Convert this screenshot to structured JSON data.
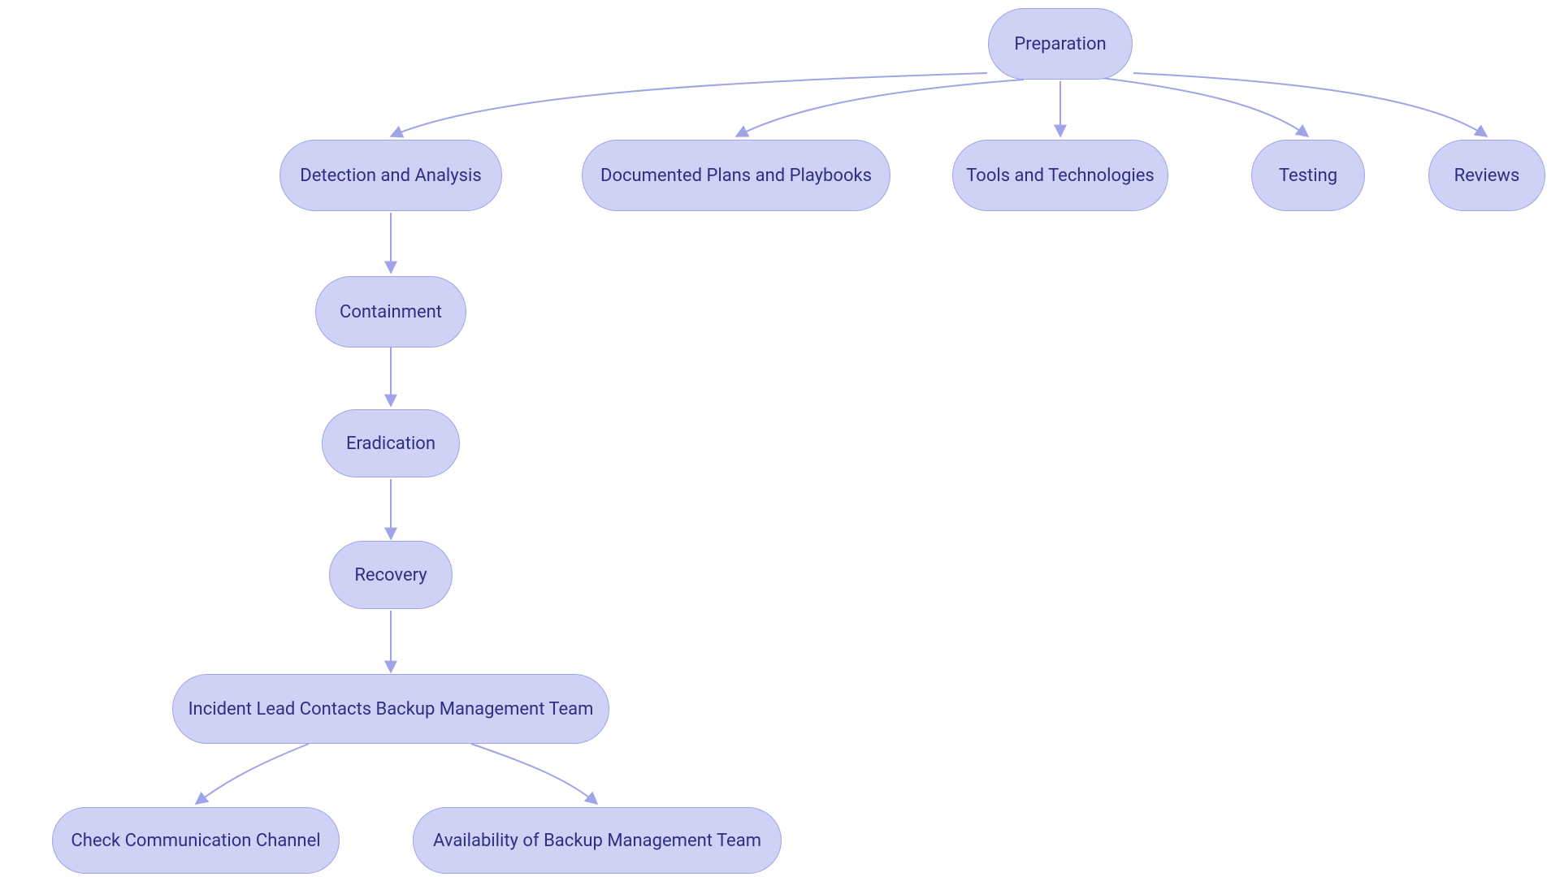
{
  "nodes": {
    "preparation": {
      "label": "Preparation"
    },
    "detection": {
      "label": "Detection and Analysis"
    },
    "docplans": {
      "label": "Documented Plans and Playbooks"
    },
    "tools": {
      "label": "Tools and Technologies"
    },
    "testing": {
      "label": "Testing"
    },
    "reviews": {
      "label": "Reviews"
    },
    "containment": {
      "label": "Containment"
    },
    "eradication": {
      "label": "Eradication"
    },
    "recovery": {
      "label": "Recovery"
    },
    "incidentlead": {
      "label": "Incident Lead Contacts Backup Management Team"
    },
    "checkcomm": {
      "label": "Check Communication Channel"
    },
    "availbackup": {
      "label": "Availability of Backup Management Team"
    }
  },
  "colors": {
    "node_fill": "#cfd1f5",
    "node_border": "#9fa3e8",
    "node_text": "#2d2f82",
    "edge": "#9fa3e8"
  }
}
